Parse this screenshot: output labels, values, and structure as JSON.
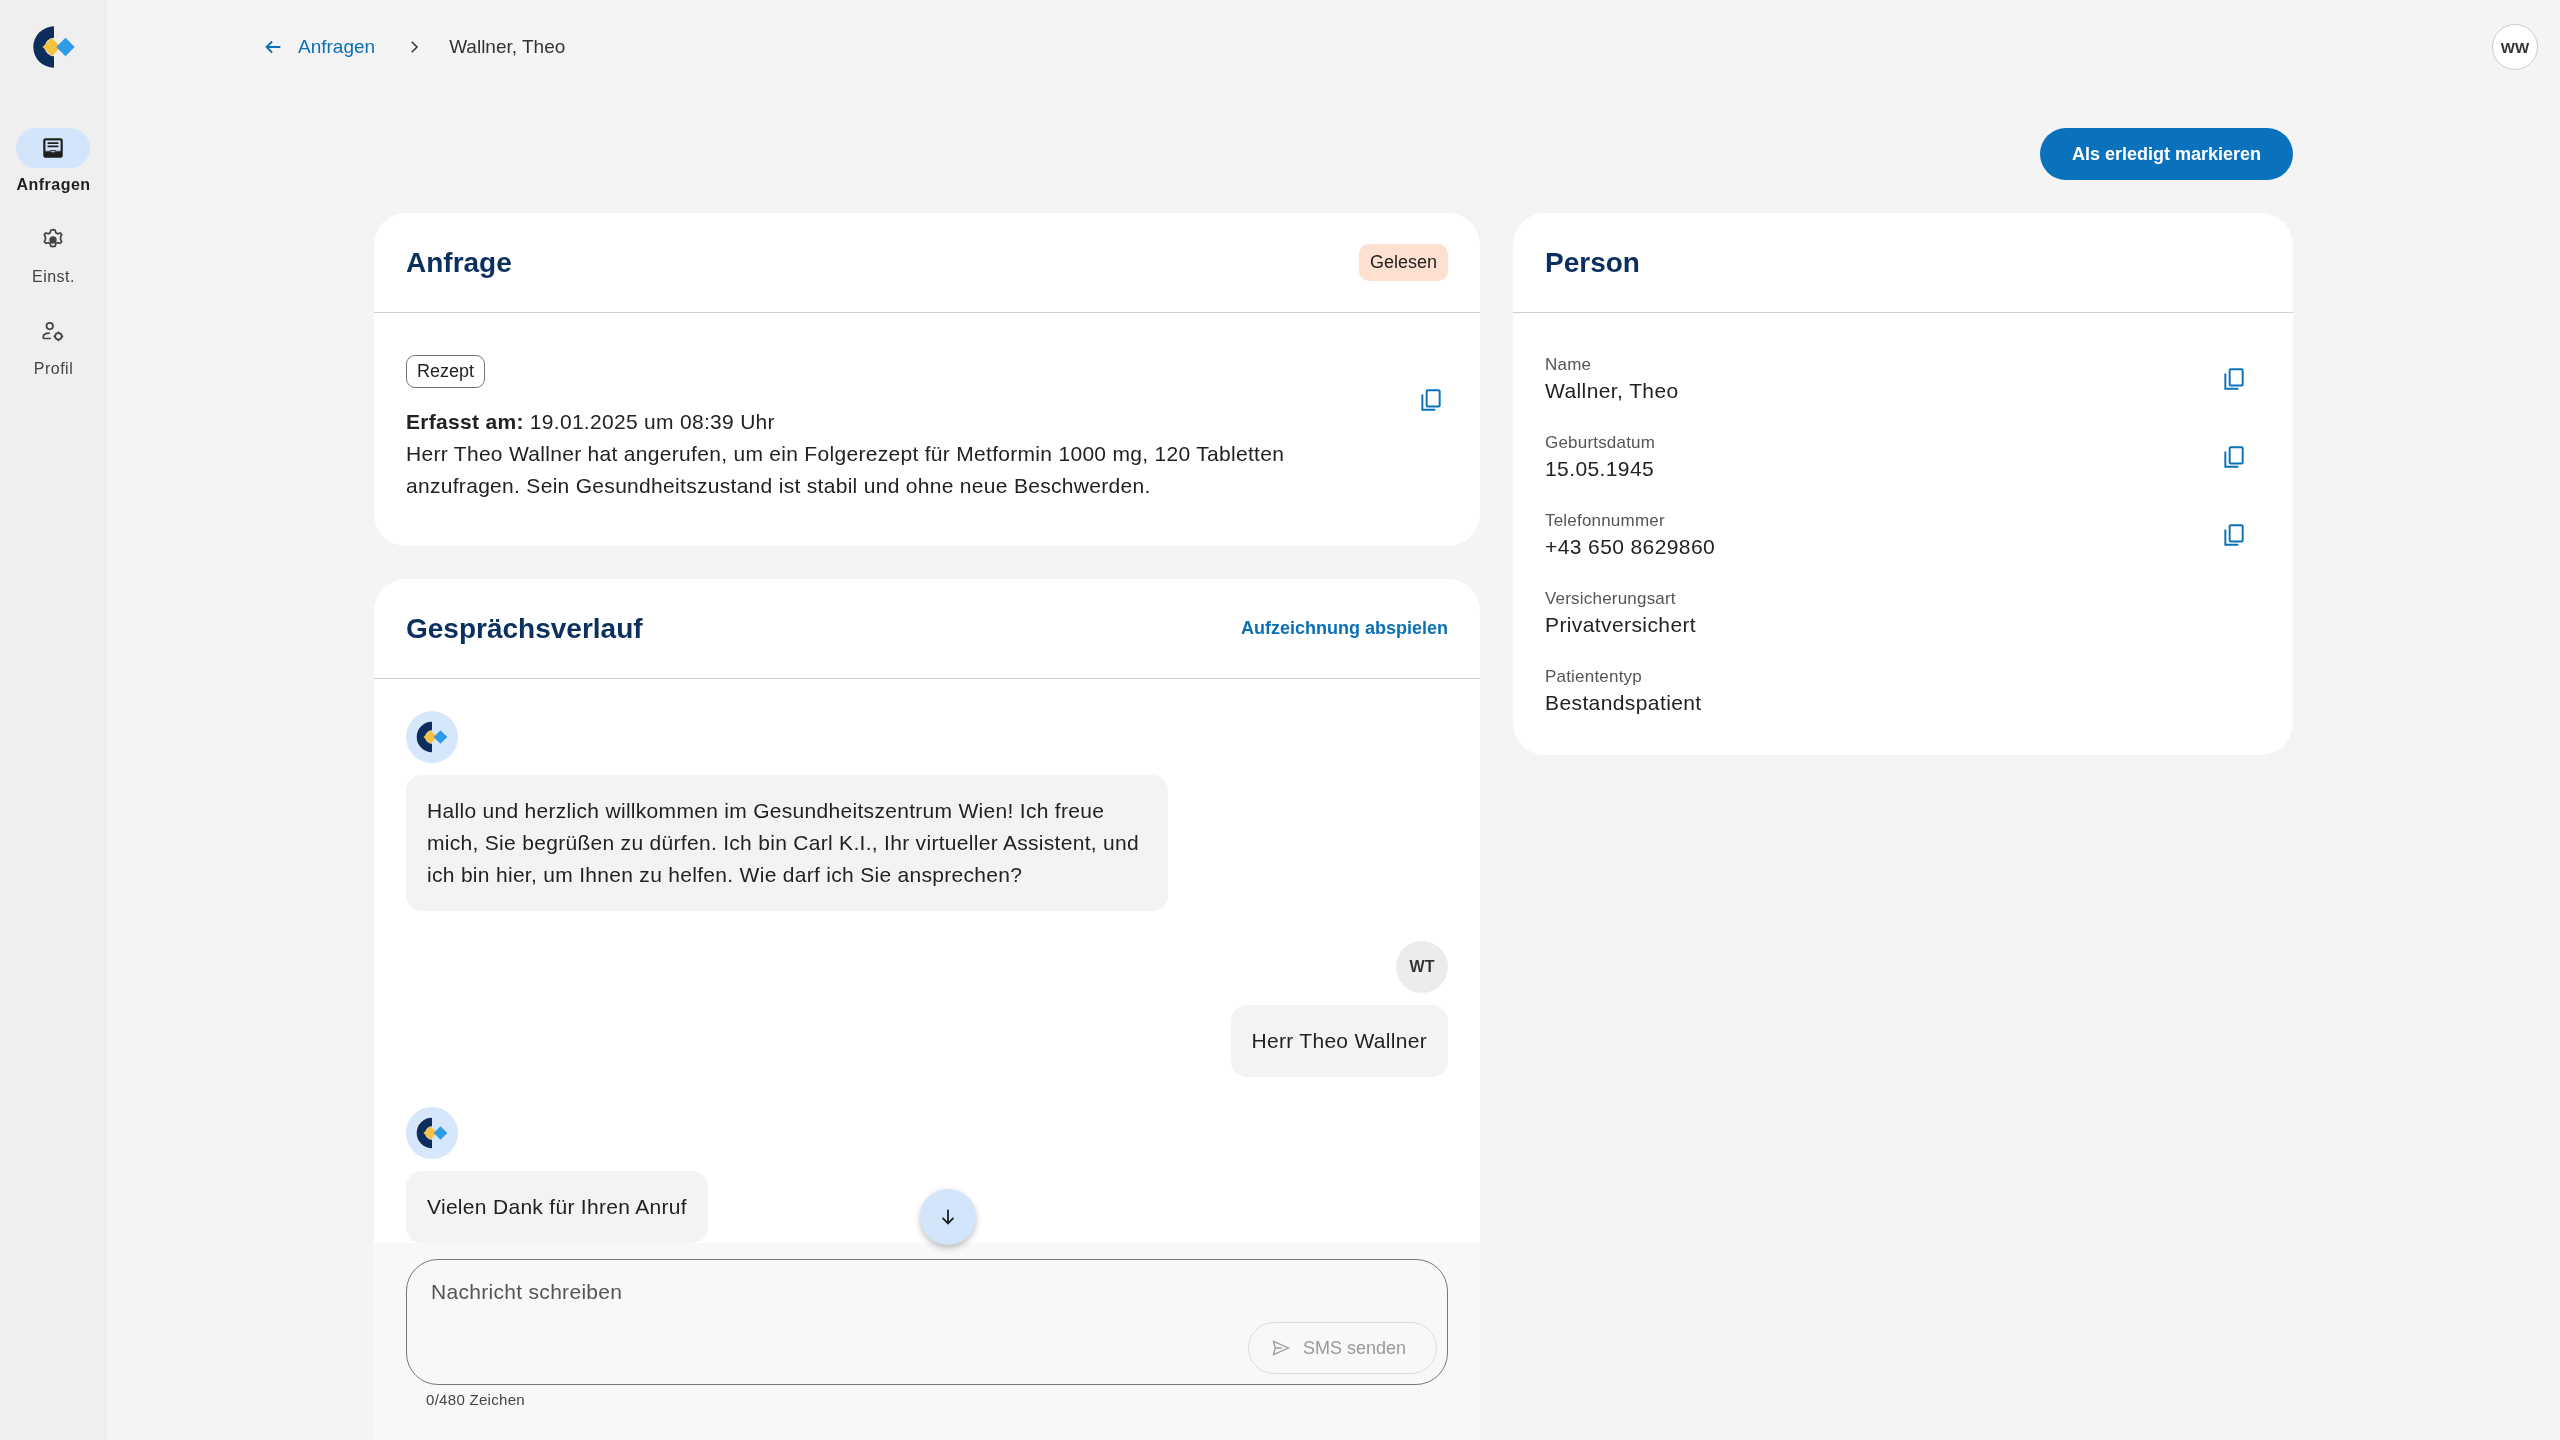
{
  "sidebar": {
    "items": [
      {
        "label": "Anfragen",
        "kind": "inbox",
        "selected": true
      },
      {
        "label": "Einst.",
        "kind": "gear",
        "selected": false
      },
      {
        "label": "Profil",
        "kind": "user-gear",
        "selected": false
      }
    ]
  },
  "breadcrumb": {
    "back": "Anfragen",
    "current": "Wallner, Theo"
  },
  "user_avatar": "WW",
  "primary_action": "Als erledigt markieren",
  "request": {
    "title": "Anfrage",
    "status": "Gelesen",
    "tag": "Rezept",
    "recorded": "**Erfasst am:** 19.01.2025 um 08:39 Uhr",
    "summary": "Herr Theo Wallner hat angerufen, um ein Folgerezept für Metformin 1000 mg, 120 Tabletten anzufragen. Sein Gesundheitszustand ist stabil und ohne neue Beschwerden."
  },
  "conversation": {
    "title": "Gesprächsverlauf",
    "action": "Aufzeichnung abspielen",
    "messages": [
      {
        "kind": "bot",
        "text": "Hallo und herzlich willkommen im Gesundheitszentrum Wien! Ich freue mich, Sie begrüßen zu dürfen. Ich bin Carl K.I., Ihr virtueller Assistent, und ich bin hier, um Ihnen zu helfen. Wie darf ich Sie ansprechen?"
      },
      {
        "kind": "user",
        "initials": "WT",
        "text": "Herr Theo Wallner"
      },
      {
        "kind": "bot",
        "text": "Vielen Dank für Ihren Anruf"
      }
    ]
  },
  "composer": {
    "placeholder": "Nachricht schreiben",
    "send": "SMS senden",
    "send_disabled": true,
    "counter": "0/480 Zeichen"
  },
  "person": {
    "title": "Person",
    "fields": [
      {
        "label": "Name",
        "value": "Wallner, Theo",
        "copyable": true
      },
      {
        "label": "Geburtsdatum",
        "value": "15.05.1945",
        "copyable": true
      },
      {
        "label": "Telefonnummer",
        "value": "+43 650 8629860",
        "copyable": true
      },
      {
        "label": "Versicherungsart",
        "value": "Privatversichert",
        "copyable": false
      },
      {
        "label": "Patiententyp",
        "value": "Bestandspatient",
        "copyable": false
      }
    ]
  }
}
